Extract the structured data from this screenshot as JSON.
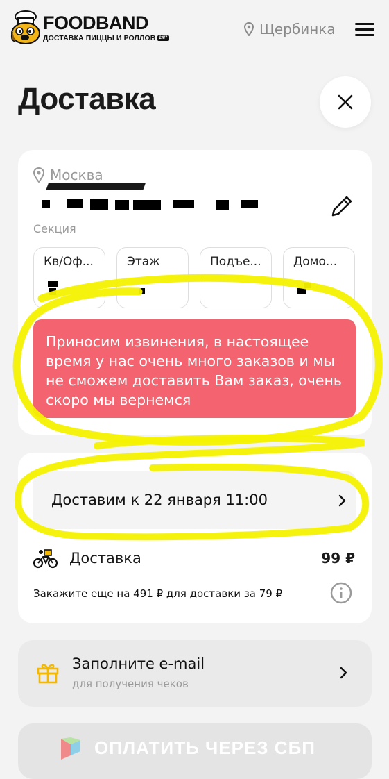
{
  "header": {
    "brand": "FOODBAND",
    "tagline": "ДОСТАВКА ПИЦЦЫ И РОЛЛОВ",
    "badge": "24/7",
    "city": "Щербинка",
    "icons": {
      "location": "location-pin-icon",
      "menu": "hamburger-menu-icon"
    }
  },
  "page": {
    "title": "Доставка",
    "close_icon": "close-icon"
  },
  "address": {
    "city": "Москва",
    "section_label": "Секция",
    "edit_icon": "pencil-icon",
    "fields": [
      {
        "label": "Кв/Оф..."
      },
      {
        "label": "Этаж"
      },
      {
        "label": "Подъе..."
      },
      {
        "label": "Домо..."
      }
    ],
    "alert": "Приносим извинения, в настоящее время у нас очень много заказов и мы не сможем доставить Вам заказ, очень скоро мы вернемся"
  },
  "delivery": {
    "time_label": "Доставим к 22 января 11:00",
    "label": "Доставка",
    "price": "99 ₽",
    "hint": "Закажите еще на 491 ₽ для доставки за 79 ₽",
    "icons": {
      "bike": "bicycle-icon",
      "info": "info-icon",
      "chevron": "chevron-right-icon"
    }
  },
  "email": {
    "title": "Заполните e-mail",
    "subtitle": "для получения чеков",
    "icon": "gift-icon"
  },
  "payment": {
    "label": "ОПЛАТИТЬ ЧЕРЕЗ СБП",
    "icon": "sbp-logo-icon"
  },
  "colors": {
    "background": "#f3f3f3",
    "card": "#ffffff",
    "alert": "#f36470",
    "gift": "#f5b800",
    "highlight": "#f7f500"
  }
}
